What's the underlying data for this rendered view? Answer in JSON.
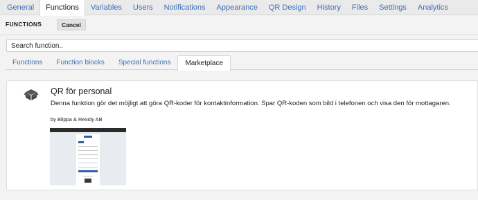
{
  "topnav": {
    "tabs": [
      "General",
      "Functions",
      "Variables",
      "Users",
      "Notifications",
      "Appearance",
      "QR Design",
      "History",
      "Files",
      "Settings",
      "Analytics"
    ],
    "active": "Functions"
  },
  "header": {
    "title": "FUNCTIONS",
    "cancel_label": "Cancel"
  },
  "search": {
    "placeholder": "Search function.."
  },
  "subtabs": {
    "tabs": [
      "Functions",
      "Function blocks",
      "Special functions",
      "Marketplace"
    ],
    "active": "Marketplace"
  },
  "card": {
    "icon": "package-box-icon",
    "name": "QR för personal",
    "description": "Denna funktion gör det möjligt att göra QR-koder för kontaktinformation. Spar QR-koden som bild i telefonen och visa den för mottagaren.",
    "author": "by Blippa & Rexidy AB"
  },
  "colors": {
    "link": "#3a6fb5",
    "accent": "#2f5ea8"
  }
}
